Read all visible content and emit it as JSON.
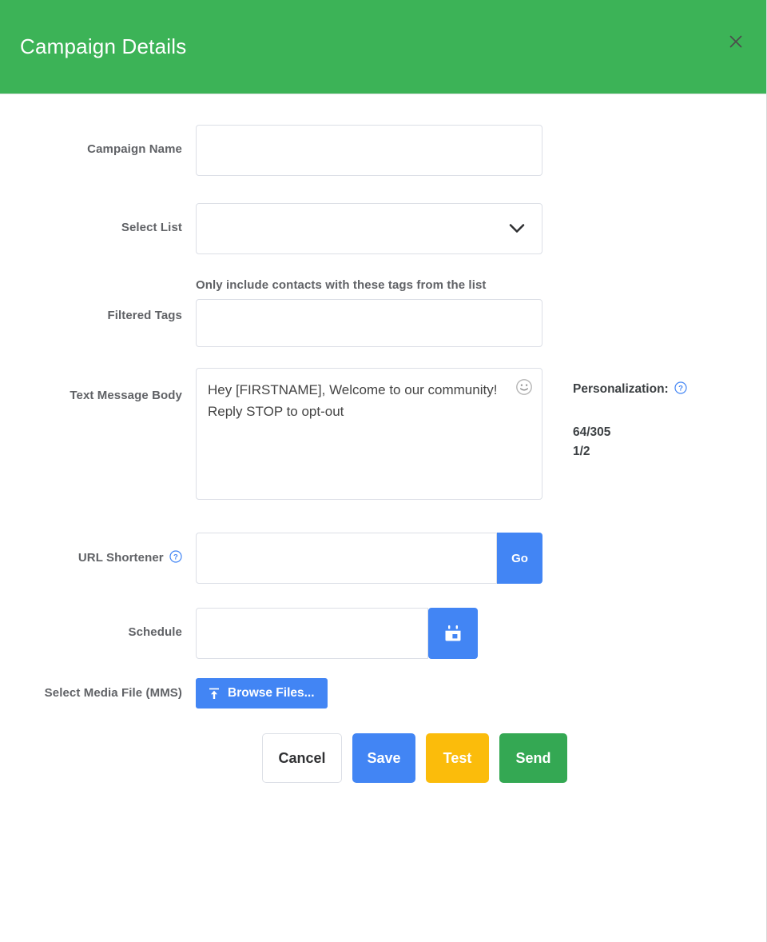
{
  "header": {
    "title": "Campaign Details",
    "close_icon": "close-icon",
    "background_color": "#3cb357"
  },
  "form": {
    "campaign_name": {
      "label": "Campaign Name",
      "value": "",
      "placeholder": ""
    },
    "select_list": {
      "label": "Select List",
      "value": "",
      "placeholder": "",
      "chevron_icon": "chevron-down-icon"
    },
    "filtered_tags": {
      "label": "Filtered Tags",
      "helper_text": "Only include contacts with these tags from the list",
      "value": "",
      "placeholder": ""
    },
    "text_message_body": {
      "label": "Text Message Body",
      "value": "Hey [FIRSTNAME], Welcome to our community! Reply STOP to opt-out",
      "placeholder": "",
      "emoji_icon": "emoji-smiley-icon"
    },
    "personalization": {
      "label": "Personalization:",
      "help_icon": "help-circle-icon",
      "character_count": "64/305",
      "segment_count": "1/2"
    },
    "url_shortener": {
      "label": "URL Shortener",
      "help_icon": "help-circle-icon",
      "value": "",
      "placeholder": "",
      "go_label": "Go"
    },
    "schedule": {
      "label": "Schedule",
      "value": "",
      "placeholder": "",
      "calendar_icon": "calendar-icon"
    },
    "media_file": {
      "label": "Select Media File (MMS)",
      "browse_label": "Browse Files...",
      "upload_icon": "upload-icon"
    }
  },
  "actions": {
    "cancel": "Cancel",
    "save": "Save",
    "test": "Test",
    "send": "Send"
  },
  "colors": {
    "header_green": "#3cb357",
    "primary_blue": "#4285f4",
    "warning_yellow": "#fbbc0b",
    "success_green": "#34a853",
    "link_blue": "#4285f4",
    "border_gray": "#dcdfe6",
    "label_gray": "#606266"
  }
}
